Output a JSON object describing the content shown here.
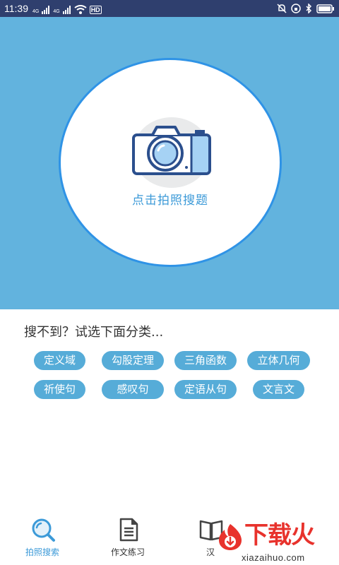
{
  "status_bar": {
    "time": "11:39",
    "network_1": "4G",
    "network_2": "4G",
    "hd_badge": "HD"
  },
  "hero": {
    "camera_label": "点击拍照搜题"
  },
  "suggestions": {
    "title": "搜不到？试选下面分类...",
    "tags": [
      "定义域",
      "勾股定理",
      "三角函数",
      "立体几何",
      "祈使句",
      "感叹句",
      "定语从句",
      "文言文"
    ]
  },
  "bottom_nav": {
    "items": [
      {
        "label": "拍照搜索",
        "icon": "search-icon",
        "active": true
      },
      {
        "label": "作文练习",
        "icon": "document-icon",
        "active": false
      },
      {
        "label": "汉",
        "icon": "book-icon",
        "active": false
      }
    ]
  },
  "watermark": {
    "brand": "下载火",
    "url": "xiazaihuo.com"
  },
  "colors": {
    "hero_bg": "#62b3de",
    "circle_border": "#2f93e6",
    "tag_bg": "#56acd8",
    "active_nav": "#3c9ad8",
    "brand_red": "#e8322c"
  }
}
